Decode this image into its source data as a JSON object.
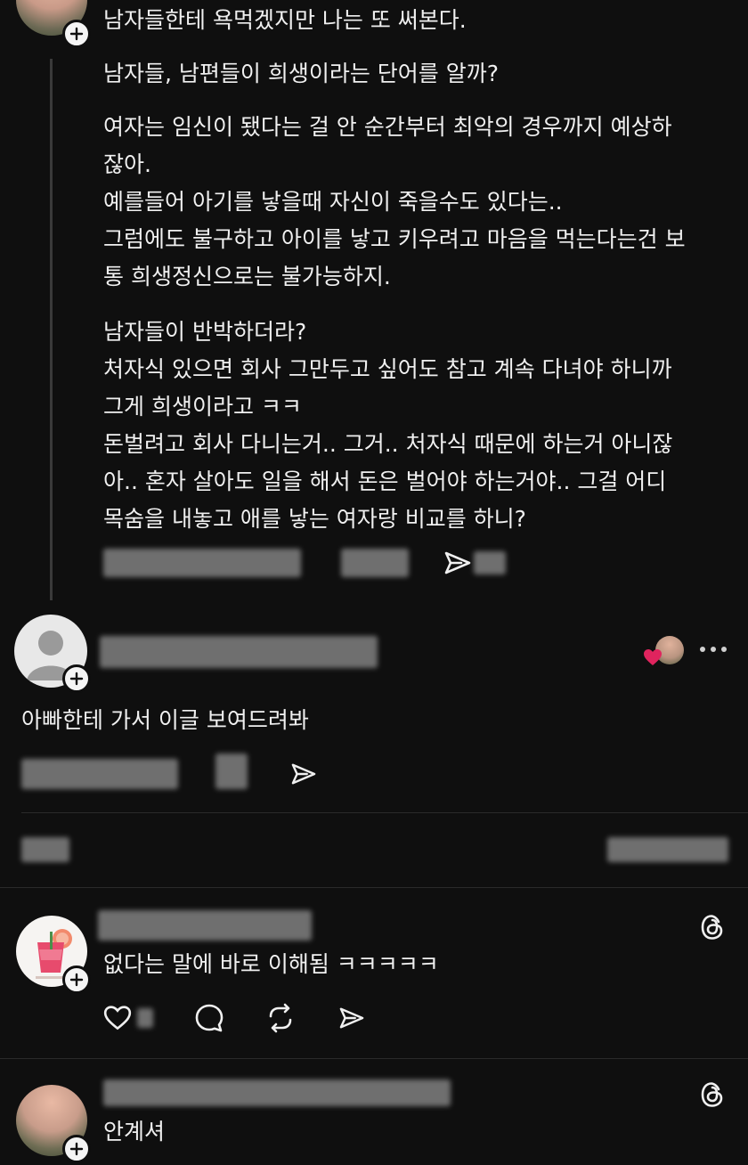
{
  "post1": {
    "header_line": "남자들한테 욕먹겠지만 나는 또 써본다.",
    "paragraphs": [
      [
        "남자들, 남편들이 희생이라는 단어를 알까?"
      ],
      [
        "여자는 임신이 됐다는 걸 안 순간부터 최악의 경우까지 예상하",
        "잖아.",
        "예를들어 아기를 낳을때 자신이 죽을수도 있다는..",
        "그럼에도 불구하고 아이를 낳고 키우려고 마음을 먹는다는건 보",
        "통 희생정신으로는 불가능하지."
      ],
      [
        "남자들이 반박하더라?",
        "처자식 있으면 회사 그만두고 싶어도 참고 계속 다녀야 하니까",
        "그게 희생이라고 ㅋㅋ",
        "돈벌려고 회사 다니는거.. 그거.. 처자식 때문에 하는거 아니잖",
        "아.. 혼자 살아도 일을 해서 돈은 벌어야 하는거야.. 그걸 어디",
        "목숨을 내놓고 애를 낳는 여자랑 비교를 하니?"
      ]
    ]
  },
  "reply1": {
    "text": "아빠한테 가서 이글 보여드려봐"
  },
  "reply2": {
    "text": "없다는 말에 바로 이해됨 ㅋㅋㅋㅋㅋ"
  },
  "reply3": {
    "text": "안계셔"
  },
  "icons": {
    "plus": "plus-icon",
    "share": "send-icon",
    "more": "more-icon",
    "threads": "threads-logo-icon",
    "like": "heart-icon",
    "comment": "comment-icon",
    "repost": "repost-icon",
    "liked_heart": "heart-icon"
  },
  "colors": {
    "background": "#0f0f0f",
    "text": "#f0f0f0",
    "heart": "#e0245e"
  }
}
